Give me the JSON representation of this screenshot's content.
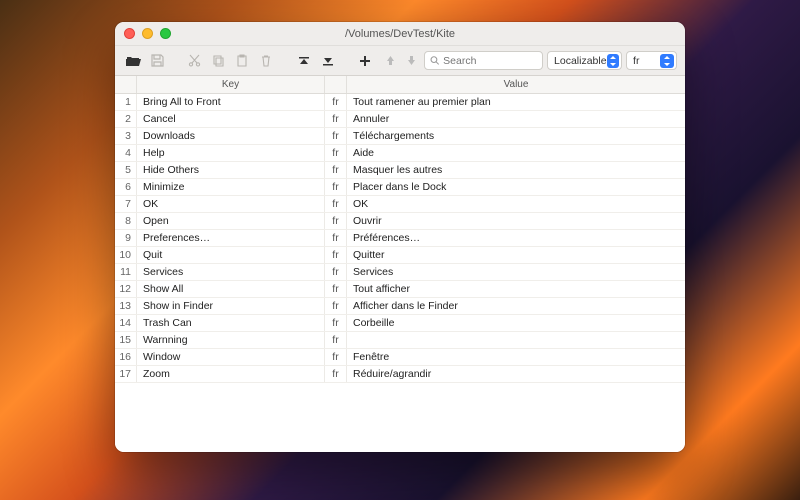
{
  "window": {
    "title": "/Volumes/DevTest/Kite"
  },
  "toolbar": {
    "search_placeholder": "Search",
    "dropdown1": "Localizable",
    "dropdown2": "fr"
  },
  "columns": {
    "key": "Key",
    "value": "Value"
  },
  "lang": "fr",
  "rows": [
    {
      "n": "1",
      "key": "Bring All to Front",
      "value": "Tout ramener au premier plan"
    },
    {
      "n": "2",
      "key": "Cancel",
      "value": "Annuler"
    },
    {
      "n": "3",
      "key": "Downloads",
      "value": "Téléchargements"
    },
    {
      "n": "4",
      "key": "Help",
      "value": "Aide"
    },
    {
      "n": "5",
      "key": "Hide Others",
      "value": "Masquer les autres"
    },
    {
      "n": "6",
      "key": "Minimize",
      "value": "Placer dans le Dock"
    },
    {
      "n": "7",
      "key": "OK",
      "value": "OK"
    },
    {
      "n": "8",
      "key": "Open",
      "value": "Ouvrir"
    },
    {
      "n": "9",
      "key": "Preferences…",
      "value": "Préférences…"
    },
    {
      "n": "10",
      "key": "Quit",
      "value": "Quitter"
    },
    {
      "n": "11",
      "key": "Services",
      "value": "Services"
    },
    {
      "n": "12",
      "key": "Show All",
      "value": "Tout afficher"
    },
    {
      "n": "13",
      "key": "Show in Finder",
      "value": "Afficher dans le Finder"
    },
    {
      "n": "14",
      "key": "Trash Can",
      "value": "Corbeille"
    },
    {
      "n": "15",
      "key": "Warnning",
      "value": ""
    },
    {
      "n": "16",
      "key": "Window",
      "value": "Fenêtre"
    },
    {
      "n": "17",
      "key": "Zoom",
      "value": "Réduire/agrandir"
    }
  ]
}
